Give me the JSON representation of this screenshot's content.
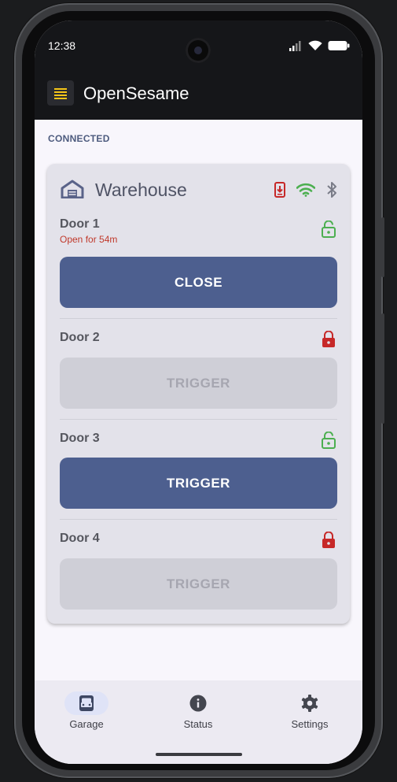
{
  "status_bar": {
    "time": "12:38"
  },
  "app_bar": {
    "title": "OpenSesame"
  },
  "connection": {
    "status": "CONNECTED"
  },
  "location": {
    "name": "Warehouse",
    "icons": [
      "home-icon",
      "phone-alert-icon",
      "wifi-icon",
      "bluetooth-icon"
    ]
  },
  "doors": [
    {
      "name": "Door 1",
      "status": "Open for 54m",
      "lock": "unlocked",
      "button": "CLOSE",
      "enabled": true
    },
    {
      "name": "Door 2",
      "status": "",
      "lock": "locked",
      "button": "TRIGGER",
      "enabled": false
    },
    {
      "name": "Door 3",
      "status": "",
      "lock": "unlocked",
      "button": "TRIGGER",
      "enabled": true
    },
    {
      "name": "Door 4",
      "status": "",
      "lock": "locked",
      "button": "TRIGGER",
      "enabled": false
    }
  ],
  "nav": {
    "items": [
      {
        "label": "Garage",
        "icon": "garage-car-icon",
        "selected": true
      },
      {
        "label": "Status",
        "icon": "info-icon",
        "selected": false
      },
      {
        "label": "Settings",
        "icon": "gear-icon",
        "selected": false
      }
    ]
  },
  "colors": {
    "accent": "#4d5f8f",
    "unlocked": "#4caf50",
    "locked": "#c62828",
    "open_status": "#c0392b"
  }
}
